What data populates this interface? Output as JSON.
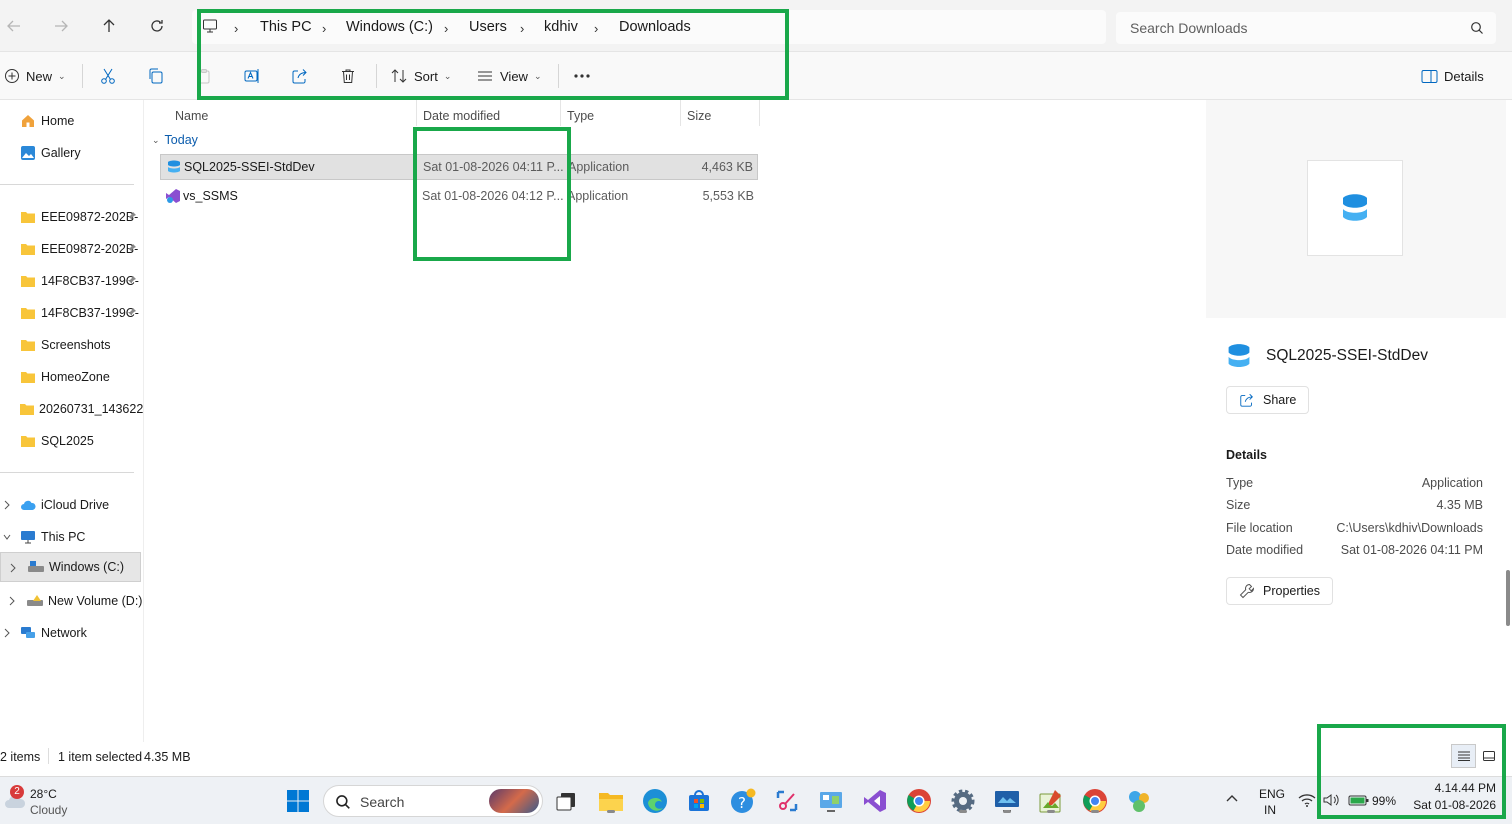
{
  "nav_buttons": {
    "back": "back-arrow-icon",
    "forward": "forward-arrow-icon",
    "up": "up-arrow-icon",
    "refresh": "refresh-icon"
  },
  "breadcrumb": [
    "This PC",
    "Windows (C:)",
    "Users",
    "kdhiv",
    "Downloads"
  ],
  "search": {
    "placeholder": "Search Downloads"
  },
  "toolbar": {
    "new_label": "New",
    "sort_label": "Sort",
    "view_label": "View",
    "details_label": "Details"
  },
  "sidebar": {
    "top": [
      {
        "label": "Home"
      },
      {
        "label": "Gallery"
      }
    ],
    "pinned": [
      {
        "label": "EEE09872-202B-"
      },
      {
        "label": "EEE09872-202B-"
      },
      {
        "label": "14F8CB37-199C-"
      },
      {
        "label": "14F8CB37-199C-"
      },
      {
        "label": "Screenshots"
      },
      {
        "label": "HomeoZone"
      },
      {
        "label": "20260731_143622"
      },
      {
        "label": "SQL2025"
      }
    ],
    "drives": [
      {
        "label": "iCloud Drive"
      },
      {
        "label": "This PC"
      },
      {
        "label": "Windows (C:)"
      },
      {
        "label": "New Volume (D:)"
      },
      {
        "label": "Network"
      }
    ]
  },
  "columns": [
    "Name",
    "Date modified",
    "Type",
    "Size"
  ],
  "group_label": "Today",
  "files": [
    {
      "name": "SQL2025-SSEI-StdDev",
      "date": "Sat 01-08-2026 04:11 P...",
      "type": "Application",
      "size": "4,463 KB"
    },
    {
      "name": "vs_SSMS",
      "date": "Sat 01-08-2026 04:12 P...",
      "type": "Application",
      "size": "5,553 KB"
    }
  ],
  "details_pane": {
    "file_name": "SQL2025-SSEI-StdDev",
    "share_label": "Share",
    "section_title": "Details",
    "props": [
      {
        "key": "Type",
        "value": "Application"
      },
      {
        "key": "Size",
        "value": "4.35 MB"
      },
      {
        "key": "File location",
        "value": "C:\\Users\\kdhiv\\Downloads"
      },
      {
        "key": "Date modified",
        "value": "Sat 01-08-2026 04:11 PM"
      }
    ],
    "properties_label": "Properties"
  },
  "status": {
    "items": "2 items",
    "selected": "1 item selected",
    "size": "4.35 MB"
  },
  "taskbar": {
    "weather_badge": "2",
    "temp": "28°C",
    "weather": "Cloudy",
    "search_label": "Search",
    "lang": "ENG",
    "region": "IN",
    "battery": "99%",
    "time": "4.14.44 PM",
    "date": "Sat 01-08-2026"
  },
  "colors": {
    "accent": "#0067c0",
    "highlight": "#19a84a",
    "folder": "#f8c53a"
  }
}
